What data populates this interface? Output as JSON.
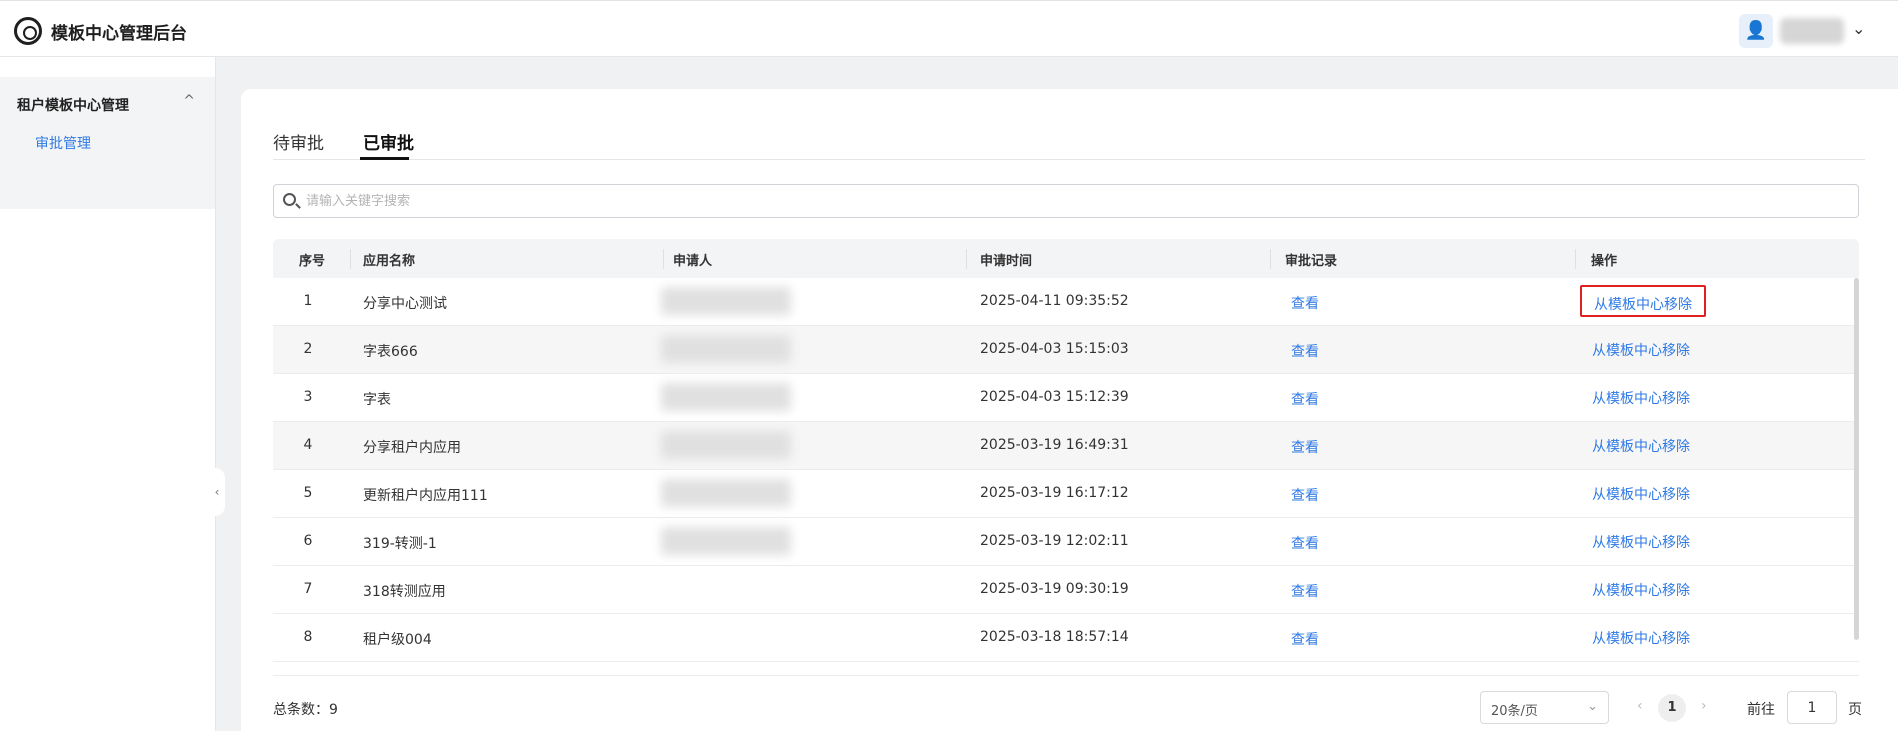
{
  "header": {
    "app_title": "模板中心管理后台",
    "logo_icon": "logo-icon",
    "user_icon": "user-icon",
    "chevron": "⌄"
  },
  "sidebar": {
    "group_label": "租户模板中心管理",
    "group_caret": "^",
    "items": [
      {
        "label": "审批管理",
        "active": true
      }
    ],
    "collapse_glyph": "‹"
  },
  "tabs": [
    {
      "label": "待审批",
      "active": false
    },
    {
      "label": "已审批",
      "active": true
    }
  ],
  "search": {
    "placeholder": "请输入关键字搜索",
    "value": ""
  },
  "table": {
    "columns": [
      "序号",
      "应用名称",
      "申请人",
      "申请时间",
      "审批记录",
      "操作"
    ],
    "rows": [
      {
        "index": "1",
        "app_name": "分享中心测试",
        "time": "2025-04-11 09:35:52",
        "record": "查看",
        "action": "从模板中心移除",
        "highlighted": true
      },
      {
        "index": "2",
        "app_name": "字表666",
        "time": "2025-04-03 15:15:03",
        "record": "查看",
        "action": "从模板中心移除"
      },
      {
        "index": "3",
        "app_name": "字表",
        "time": "2025-04-03 15:12:39",
        "record": "查看",
        "action": "从模板中心移除"
      },
      {
        "index": "4",
        "app_name": "分享租户内应用",
        "time": "2025-03-19 16:49:31",
        "record": "查看",
        "action": "从模板中心移除"
      },
      {
        "index": "5",
        "app_name": "更新租户内应用111",
        "time": "2025-03-19 16:17:12",
        "record": "查看",
        "action": "从模板中心移除"
      },
      {
        "index": "6",
        "app_name": "319-转测-1",
        "time": "2025-03-19 12:02:11",
        "record": "查看",
        "action": "从模板中心移除"
      },
      {
        "index": "7",
        "app_name": "318转测应用",
        "time": "2025-03-19 09:30:19",
        "record": "查看",
        "action": "从模板中心移除"
      },
      {
        "index": "8",
        "app_name": "租户级004",
        "time": "2025-03-18 18:57:14",
        "record": "查看",
        "action": "从模板中心移除"
      }
    ]
  },
  "footer": {
    "total_label": "总条数：",
    "total_count": "9",
    "page_size": "20条/页",
    "current_page": "1",
    "goto_label": "前往",
    "goto_value": "1",
    "goto_suffix": "页"
  },
  "colors": {
    "accent": "#2f7ae5",
    "highlight_border": "#e02020"
  }
}
